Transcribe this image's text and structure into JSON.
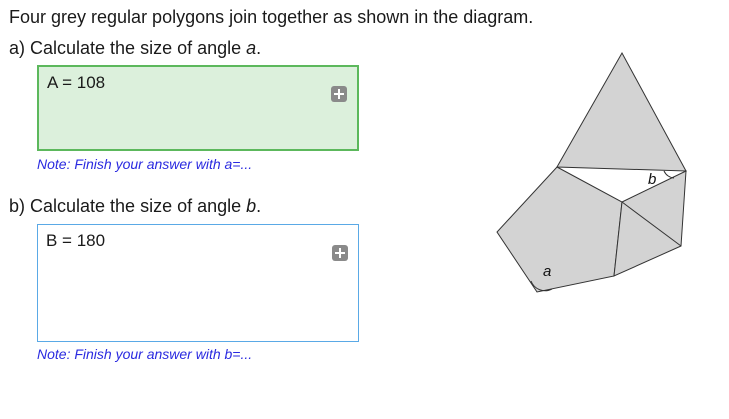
{
  "intro": "Four grey regular polygons join together as shown in the diagram.",
  "part_a": {
    "prefix": "a) Calculate the size of angle ",
    "var": "a",
    "suffix": ".",
    "answer": "A = 108",
    "note": "Note: Finish your answer with a=...",
    "status": "correct"
  },
  "part_b": {
    "prefix": "b) Calculate the size of angle ",
    "var": "b",
    "suffix": ".",
    "answer": "B = 180",
    "note": "Note: Finish your answer with b=...",
    "status": "active"
  },
  "diagram": {
    "angle_a_label": "a",
    "angle_b_label": "b",
    "fill_color": "#d3d3d3",
    "stroke_color": "#333333"
  },
  "colors": {
    "correct_fill": "#dcf0dc",
    "correct_border": "#5cb85c",
    "active_border": "#5aa9e6",
    "note_text": "#2a2ae0",
    "button_icon": "#8a8a8a"
  },
  "icons": {
    "expand_button": "plus-square-icon"
  }
}
